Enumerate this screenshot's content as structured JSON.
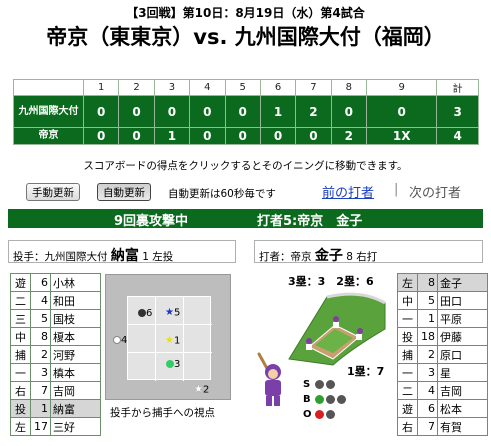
{
  "header": {
    "subtitle": "【3回戦】第10日：8月19日（水）第4試合",
    "title": "帝京（東東京）vs. 九州国際大付（福岡）"
  },
  "scoreboard": {
    "columns": [
      "1",
      "2",
      "3",
      "4",
      "5",
      "6",
      "7",
      "8",
      "9",
      "計"
    ],
    "teams": [
      {
        "name": "九州国際大付",
        "scores": [
          "0",
          "0",
          "0",
          "0",
          "0",
          "1",
          "2",
          "0",
          "0",
          "3"
        ]
      },
      {
        "name": "帝京",
        "scores": [
          "0",
          "0",
          "1",
          "0",
          "0",
          "0",
          "0",
          "2",
          "1X",
          "4"
        ]
      }
    ]
  },
  "hint": "スコアボードの得点をクリックするとそのイニングに移動できます。",
  "controls": {
    "manual_label": "手動更新",
    "auto_label": "自動更新",
    "auto_note": "自動更新は60秒毎です",
    "prev_label": "前の打者",
    "separator": "|",
    "next_label": "次の打者"
  },
  "status": {
    "inning": "9回裏攻撃中",
    "batter_header": "打者5:帝京　金子"
  },
  "pitcher": {
    "label": "投手：九州国際大付",
    "name": "納富",
    "number": "1",
    "hand": "左投"
  },
  "batter": {
    "label": "打者：帝京",
    "name": "金子",
    "number": "8",
    "hand": "右打"
  },
  "lineup_left": [
    {
      "pos": "遊",
      "no": "6",
      "name": "小林"
    },
    {
      "pos": "二",
      "no": "4",
      "name": "和田"
    },
    {
      "pos": "三",
      "no": "5",
      "name": "国枝"
    },
    {
      "pos": "中",
      "no": "8",
      "name": "榎本"
    },
    {
      "pos": "捕",
      "no": "2",
      "name": "河野"
    },
    {
      "pos": "一",
      "no": "3",
      "name": "槙本"
    },
    {
      "pos": "右",
      "no": "7",
      "name": "吉岡"
    },
    {
      "pos": "投",
      "no": "1",
      "name": "納富"
    },
    {
      "pos": "左",
      "no": "17",
      "name": "三好"
    }
  ],
  "lineup_right": [
    {
      "pos": "左",
      "no": "8",
      "name": "金子"
    },
    {
      "pos": "中",
      "no": "5",
      "name": "田口"
    },
    {
      "pos": "一",
      "no": "1",
      "name": "平原"
    },
    {
      "pos": "投",
      "no": "18",
      "name": "伊藤"
    },
    {
      "pos": "捕",
      "no": "2",
      "name": "原口"
    },
    {
      "pos": "一",
      "no": "3",
      "name": "星"
    },
    {
      "pos": "二",
      "no": "4",
      "name": "吉岡"
    },
    {
      "pos": "遊",
      "no": "6",
      "name": "松本"
    },
    {
      "pos": "右",
      "no": "7",
      "name": "有賀"
    }
  ],
  "pitches": [
    {
      "label": "6",
      "mark": "dot",
      "color": "#333333"
    },
    {
      "label": "5",
      "mark": "star",
      "color": "#2233cc"
    },
    {
      "label": "4",
      "mark": "dot",
      "color": "#ffffff"
    },
    {
      "label": "1",
      "mark": "star",
      "color": "#f0e000"
    },
    {
      "label": "3",
      "mark": "dot",
      "color": "#33cc66"
    },
    {
      "label": "2",
      "mark": "star",
      "color": "#ffffff"
    }
  ],
  "zone_caption": "投手から捕手への視点",
  "runners": {
    "text": "3塁：3　2塁：6",
    "first": "1塁：7"
  },
  "count": {
    "s_label": "S",
    "b_label": "B",
    "o_label": "O",
    "s": 0,
    "b": 1,
    "o": 1,
    "colors": {
      "s": "#f0c800",
      "b": "#2fa02f",
      "o": "#d82020",
      "off": "#555555"
    }
  },
  "colors": {
    "accent": "#0c6a1e",
    "link": "#1a3fbf"
  }
}
